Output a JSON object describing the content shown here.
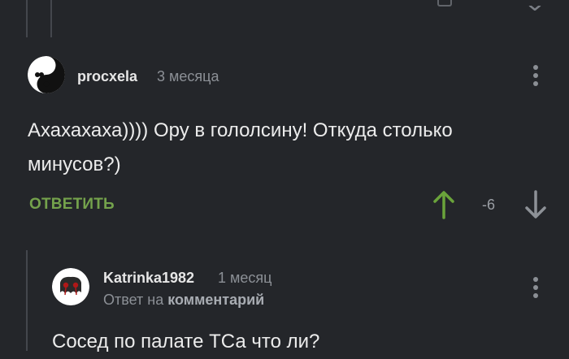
{
  "comments": [
    {
      "username": "procxela",
      "time": "3 месяца",
      "text_line1": "Ахахахаха)))) Ору в гололсину! Откуда столько",
      "text_line2": "минусов?)",
      "reply_label": "ОТВЕТИТЬ",
      "score": "-6",
      "avatar_icon": "yin-yang-avatar-icon"
    },
    {
      "username": "Katrinka1982",
      "time": "1 месяц",
      "reply_prefix": "Ответ на",
      "reply_target": "комментарий",
      "text_line1": "Сосед по палате ТСа что ли?",
      "avatar_icon": "ghost-avatar-icon"
    }
  ],
  "colors": {
    "background": "#24262a",
    "reply_green": "#74a24c",
    "upvote_green": "#6aa33b",
    "muted": "#8c9096"
  }
}
